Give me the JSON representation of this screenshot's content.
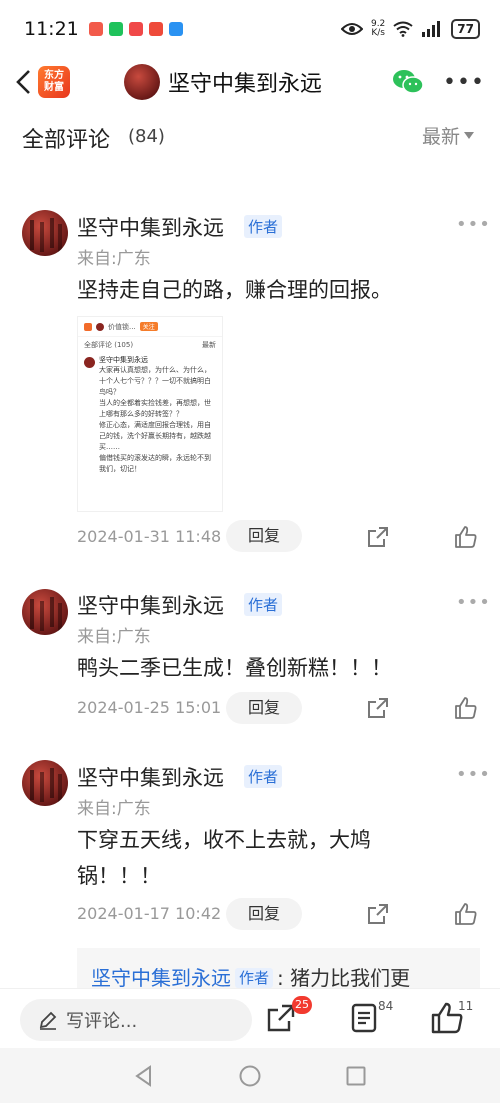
{
  "status_bar": {
    "time": "11:21",
    "net_speed_value": "9.2",
    "net_speed_unit": "K/s",
    "battery": "77",
    "app_colors": [
      "#f25a4a",
      "#1fc25b",
      "#f04848",
      "#ee4a3a",
      "#2a92f2"
    ]
  },
  "nav": {
    "brand_line1": "东方",
    "brand_line2": "财富",
    "title": "坚守中集到永远"
  },
  "section": {
    "title": "全部评论",
    "count": "(84)",
    "sort_label": "最新"
  },
  "comments": [
    {
      "name": "坚守中集到永远",
      "tag": "作者",
      "from": "来自:广东",
      "text": "坚持走自己的路，赚合理的回报。",
      "time": "2024-01-31 11:48",
      "reply_label": "回复",
      "image": {
        "follow_label": "关注",
        "top_name": "价值锁...",
        "header_title": "全部评论 (105)",
        "header_sort": "最新",
        "name": "坚守中集到永远",
        "text": "大家再认真想想，为什么、为什么，十个人七个亏？？？一切不就搞明白鸟吗？\n当人的全都着实捡钱差，再想想，世上哪有那么多的好转签？？\n修正心态，满适度回报合理钱，用自己的钱，洗个好赢长期持有，越跌越买……\n偏借钱买的滚发达的瞬，永远轮不到我们，切记！"
      }
    },
    {
      "name": "坚守中集到永远",
      "tag": "作者",
      "from": "来自:广东",
      "text": "鸭头二季已生成！叠创新糕！！！",
      "time": "2024-01-25 15:01",
      "reply_label": "回复"
    },
    {
      "name": "坚守中集到永远",
      "tag": "作者",
      "from": "来自:广东",
      "text": "下穿五天线，收不上去就，大鸠锅！！！",
      "time": "2024-01-17 10:42",
      "reply_label": "回复"
    }
  ],
  "quoted_reply": {
    "name": "坚守中集到永远",
    "tag": "作者",
    "text": ": 猪力比我们更"
  },
  "bottom_bar": {
    "input_placeholder": "写评论...",
    "share_count": "25",
    "comment_count": "84",
    "like_count": "11"
  }
}
